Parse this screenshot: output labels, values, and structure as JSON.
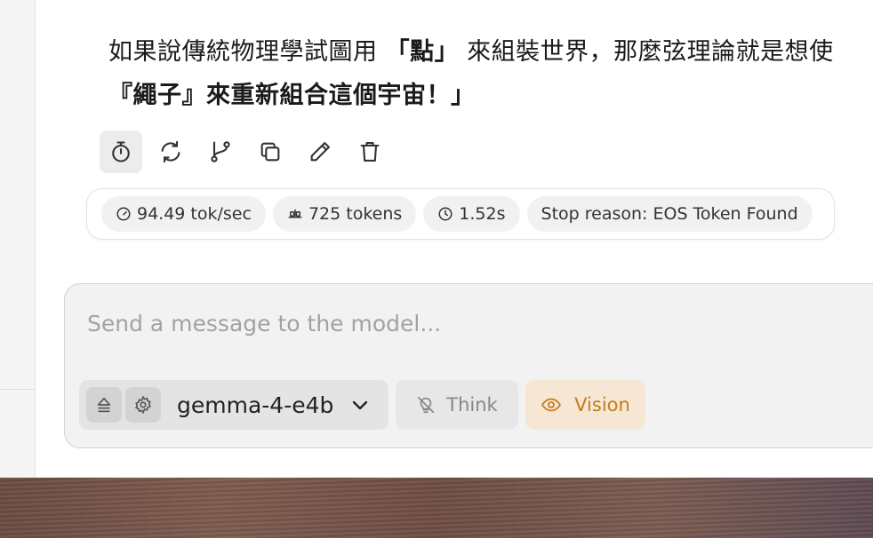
{
  "message": {
    "line1_a": "如果說傳統物理學試圖用 ",
    "line1_bold": "「點」",
    "line1_b": " 來組裝世界，那麼弦理論就是想使",
    "line2_bold": "『繩子』來重新組合這個宇宙！」"
  },
  "actions": {
    "icons": [
      "timer-icon",
      "regenerate-icon",
      "branch-icon",
      "copy-icon",
      "edit-icon",
      "delete-icon"
    ]
  },
  "stats": {
    "speed": "94.49 tok/sec",
    "tokens": "725 tokens",
    "time": "1.52s",
    "stop_reason": "Stop reason: EOS Token Found"
  },
  "composer": {
    "placeholder": "Send a message to the model...",
    "model_name": "gemma-4-e4b",
    "think_label": "Think",
    "vision_label": "Vision"
  },
  "colors": {
    "accent_vision": "#c77b1a",
    "vision_bg": "#f6e7d5"
  }
}
